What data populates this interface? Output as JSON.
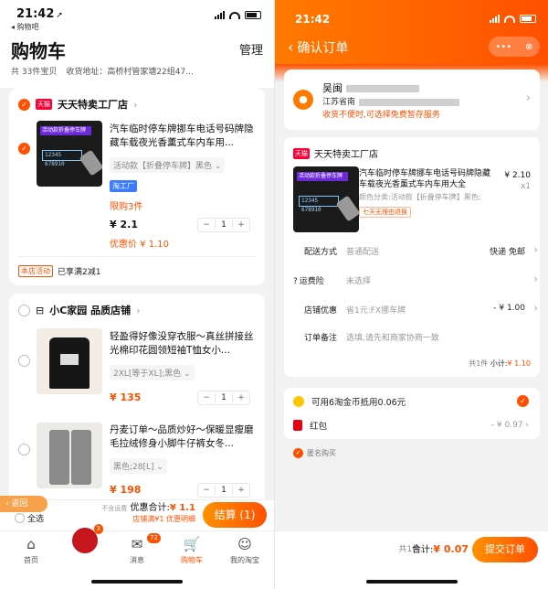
{
  "left": {
    "status": {
      "time": "21:42",
      "back_app": "◂ 购物吧"
    },
    "header": {
      "title": "购物车",
      "manage": "管理",
      "count": "共 33件宝贝",
      "address": "收货地址：高桥村管家塘22组47..."
    },
    "shop1": {
      "name": "天天特卖工厂店",
      "tmall_badge": "天猫",
      "item": {
        "title": "汽车临时停车牌挪车电话号码牌隐藏车载夜光香薰式车内车用...",
        "spec": "活动款【折叠停车牌】黑色",
        "tag": "淘工厂",
        "limit": "限购3件",
        "price": "¥ 2.1",
        "discount": "优惠价 ¥ 1.10",
        "qty": "1",
        "img_banner": "活动款折叠停车牌",
        "img_plate": "12345 678910"
      },
      "promo_tag": "本店活动",
      "promo_text": "已享满2减1"
    },
    "shop2": {
      "name": "小C家园 品质店铺",
      "item1": {
        "title": "轻盈得好像没穿衣服～真丝拼接丝光棉印花圆领短袖T恤女小...",
        "spec": "2XL[等于XL];黑色",
        "price": "¥ 135",
        "qty": "1"
      },
      "item2": {
        "title": "丹麦订单～品质炒好～保暖显瘦磨毛拉绒修身小脚牛仔裤女冬...",
        "spec": "黑色;28[L]",
        "price": "¥ 198",
        "qty": "1"
      }
    },
    "bottom": {
      "back": "返回",
      "select_all": "全选",
      "shipping_note": "不含运费",
      "total_label": "优惠合计:",
      "total_value": "¥ 1.1",
      "promo_note": "店铺满¥1",
      "promo_detail": "优惠明细",
      "checkout": "结算 (1)"
    },
    "tabs": [
      {
        "label": "首页",
        "icon": "⌂"
      },
      {
        "label": "",
        "badge": "3"
      },
      {
        "label": "消息",
        "icon": "✉",
        "badge": "72"
      },
      {
        "label": "购物车",
        "icon": "🛒"
      },
      {
        "label": "我的淘宝",
        "icon": "☺"
      }
    ]
  },
  "right": {
    "status": {
      "time": "21:42"
    },
    "title": "确认订单",
    "capsule": {
      "more": "•••",
      "close": "⊗"
    },
    "address": {
      "name": "吴闽",
      "detail": "江苏省南",
      "warn": "收货不便时,可选择免费暂存服务"
    },
    "shop": {
      "name": "天天特卖工厂店",
      "tmall_badge": "天猫"
    },
    "item": {
      "title": "汽车临时停车牌挪车电话号码牌隐藏车载夜光香薰式车内车用大全",
      "spec": "颜色分类:活动款【折叠停车牌】黑色;",
      "return_tag": "七天无理由退换",
      "price": "¥ 2.10",
      "qty": "x1"
    },
    "rows": [
      {
        "label": "配送方式",
        "mid": "普通配送",
        "value": "快递 免邮"
      },
      {
        "label": "运费险",
        "mid": "未选择",
        "value": ""
      },
      {
        "label": "店铺优惠",
        "mid": "省1元:FX挪车牌",
        "value": "- ¥ 1.00"
      },
      {
        "label": "订单备注",
        "mid": "选填,请先和商家协商一致",
        "value": ""
      }
    ],
    "subtotal": {
      "text": "共1件",
      "label": "小计:",
      "value": "¥ 1.10"
    },
    "coin": "可用6淘金币抵用0.06元",
    "redpacket": {
      "label": "红包",
      "value": "- ¥ 0.97"
    },
    "anonymous": "匿名购买",
    "bottom": {
      "count": "共1件,",
      "label": "合计:",
      "value": "¥ 0.07",
      "submit": "提交订单"
    }
  }
}
